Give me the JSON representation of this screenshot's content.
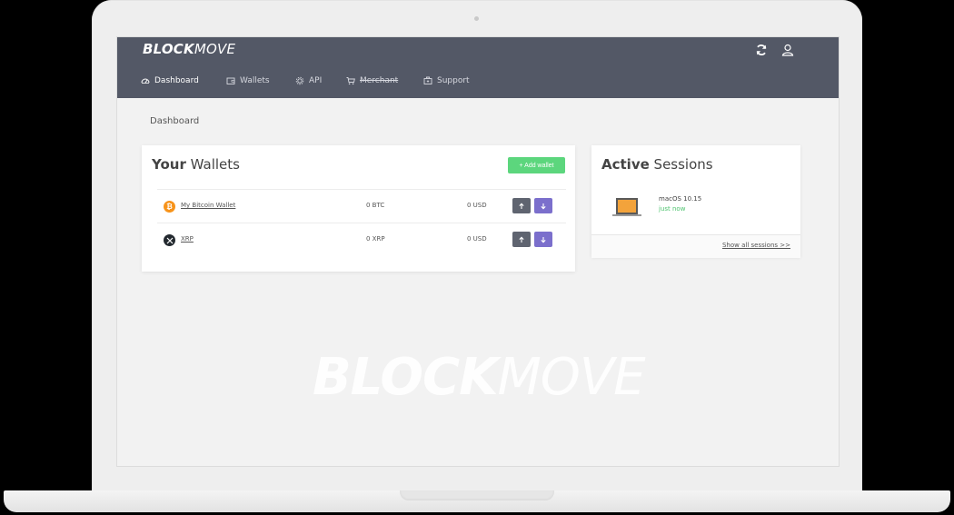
{
  "app": {
    "logo_bold": "BLOCK",
    "logo_light": "MOVE"
  },
  "toolbar": {
    "refresh_icon": "refresh-icon",
    "user_icon": "user-icon"
  },
  "nav": {
    "items": [
      {
        "label": "Dashboard",
        "icon": "dashboard-icon",
        "active": true
      },
      {
        "label": "Wallets",
        "icon": "wallet-icon"
      },
      {
        "label": "API",
        "icon": "gear-icon"
      },
      {
        "label": "Merchant",
        "icon": "cart-icon",
        "strikethrough": true
      },
      {
        "label": "Support",
        "icon": "support-icon"
      }
    ]
  },
  "breadcrumb": "Dashboard",
  "wallets": {
    "title_bold": "Your",
    "title_rest": "Wallets",
    "add_label": "+ Add wallet",
    "rows": [
      {
        "name": "My Bitcoin Wallet",
        "amount": "0 BTC",
        "usd": "0 USD",
        "coin": "bitcoin-icon",
        "color": "#f7931a"
      },
      {
        "name": "XRP",
        "amount": "0 XRP",
        "usd": "0 USD",
        "coin": "xrp-icon",
        "color": "#23292f"
      }
    ]
  },
  "sessions": {
    "title_bold": "Active",
    "title_rest": "Sessions",
    "items": [
      {
        "os": "macOS 10.15",
        "time": "just now"
      }
    ],
    "show_all": "Show all sessions >>"
  },
  "watermark": {
    "bold": "BLOCK",
    "light": "MOVE"
  },
  "colors": {
    "topbar": "#535866",
    "add_button": "#5cd67d",
    "send_button": "#5f6470",
    "receive_button": "#7b6fcc",
    "session_time": "#4fc470"
  }
}
